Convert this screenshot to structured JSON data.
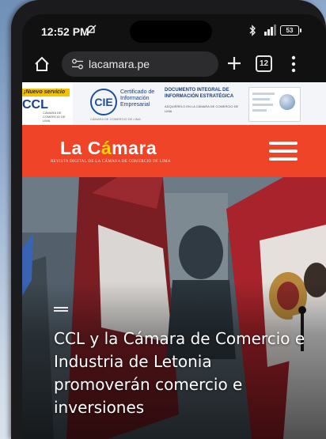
{
  "status_bar": {
    "time": "12:52 PM",
    "battery": "53"
  },
  "browser": {
    "url": "lacamara.pe",
    "tab_count": "12"
  },
  "ad_banner": {
    "ccl_tag": "¡Nuevo servicio",
    "ccl_logo": "CCL",
    "ccl_sub": "CÁMARA DE COMERCIO DE LIMA",
    "cie_logo": "CIE",
    "cie_text": "Certificado de Información Empresarial",
    "cie_sub": "CÁMARA DE COMERCIO DE LIMA",
    "doc_title": "DOCUMENTO INTEGRAL DE INFORMACIÓN ESTRATÉGICA",
    "doc_sub": "ADQUIÉRELO EN LA CÁMARA DE COMERCIO DE LIMA"
  },
  "site_header": {
    "logo_main": "La C",
    "logo_accent": "á",
    "logo_rest": "mara",
    "logo_sub": "REVISTA DIGITAL DE LA CÁMARA DE COMERCIO DE LIMA"
  },
  "article": {
    "headline": "CCL y la Cámara de Comercio e Industria de Letonia promoverán comercio e inversiones"
  },
  "colors": {
    "brand_red": "#ef4427",
    "logo_accent": "#ffd400",
    "browser_bg": "#111111"
  }
}
